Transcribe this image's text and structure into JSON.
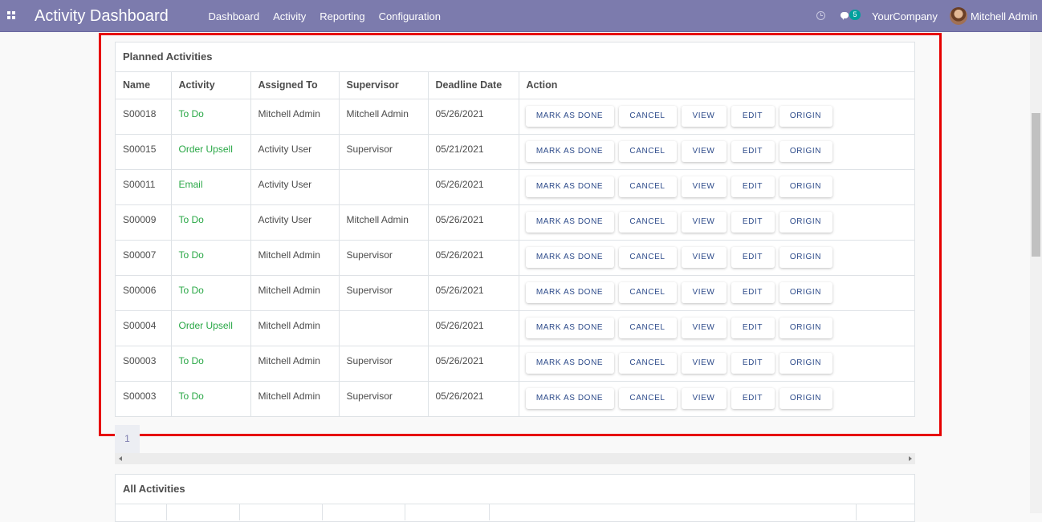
{
  "navbar": {
    "app_title": "Activity Dashboard",
    "menu": [
      "Dashboard",
      "Activity",
      "Reporting",
      "Configuration"
    ],
    "chat_count": "5",
    "company": "YourCompany",
    "user": "Mitchell Admin",
    "background_color": "#7c7bad"
  },
  "planned": {
    "title": "Planned Activities",
    "columns": [
      "Name",
      "Activity",
      "Assigned To",
      "Supervisor",
      "Deadline Date",
      "Action"
    ],
    "actions": [
      "MARK AS DONE",
      "CANCEL",
      "VIEW",
      "EDIT",
      "ORIGIN"
    ],
    "rows": [
      {
        "name": "S00018",
        "activity": "To Do",
        "assigned": "Mitchell Admin",
        "supervisor": "Mitchell Admin",
        "deadline": "05/26/2021"
      },
      {
        "name": "S00015",
        "activity": "Order Upsell",
        "assigned": "Activity User",
        "supervisor": "Supervisor",
        "deadline": "05/21/2021"
      },
      {
        "name": "S00011",
        "activity": "Email",
        "assigned": "Activity User",
        "supervisor": "",
        "deadline": "05/26/2021"
      },
      {
        "name": "S00009",
        "activity": "To Do",
        "assigned": "Activity User",
        "supervisor": "Mitchell Admin",
        "deadline": "05/26/2021"
      },
      {
        "name": "S00007",
        "activity": "To Do",
        "assigned": "Mitchell Admin",
        "supervisor": "Supervisor",
        "deadline": "05/26/2021"
      },
      {
        "name": "S00006",
        "activity": "To Do",
        "assigned": "Mitchell Admin",
        "supervisor": "Supervisor",
        "deadline": "05/26/2021"
      },
      {
        "name": "S00004",
        "activity": "Order Upsell",
        "assigned": "Mitchell Admin",
        "supervisor": "",
        "deadline": "05/26/2021"
      },
      {
        "name": "S00003",
        "activity": "To Do",
        "assigned": "Mitchell Admin",
        "supervisor": "Supervisor",
        "deadline": "05/26/2021"
      },
      {
        "name": "S00003",
        "activity": "To Do",
        "assigned": "Mitchell Admin",
        "supervisor": "Supervisor",
        "deadline": "05/26/2021"
      }
    ],
    "activity_color": "#28a745",
    "highlight_color": "#e60000"
  },
  "pager": {
    "current_page": "1"
  },
  "all_activities": {
    "title": "All Activities"
  }
}
